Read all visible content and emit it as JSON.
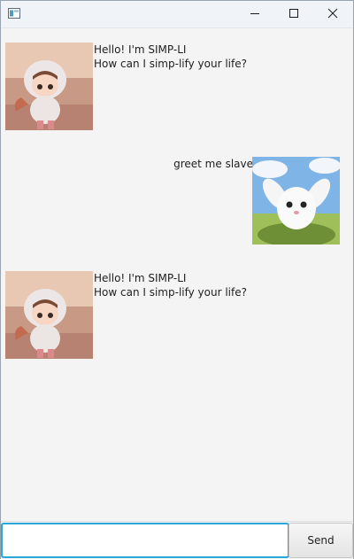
{
  "window": {
    "title": ""
  },
  "titlebar": {
    "app_icon": "window-app-icon",
    "minimize_icon": "minimize-icon",
    "maximize_icon": "maximize-icon",
    "close_icon": "close-icon"
  },
  "chat": {
    "messages": [
      {
        "sender": "bot",
        "avatar_icon": "chibi-girl-avatar",
        "lines": [
          "Hello! I'm SIMP-LI",
          "How can I simp-lify your life?"
        ]
      },
      {
        "sender": "user",
        "avatar_icon": "bunny-avatar",
        "lines": [
          "greet me slave"
        ]
      },
      {
        "sender": "bot",
        "avatar_icon": "chibi-girl-avatar",
        "lines": [
          "Hello! I'm SIMP-LI",
          "How can I simp-lify your life?"
        ]
      }
    ]
  },
  "input": {
    "value": "",
    "placeholder": ""
  },
  "send_button": {
    "label": "Send"
  },
  "colors": {
    "focus_border": "#2aa6d8",
    "titlebar": "#f0f4f9",
    "background": "#f4f4f4"
  }
}
